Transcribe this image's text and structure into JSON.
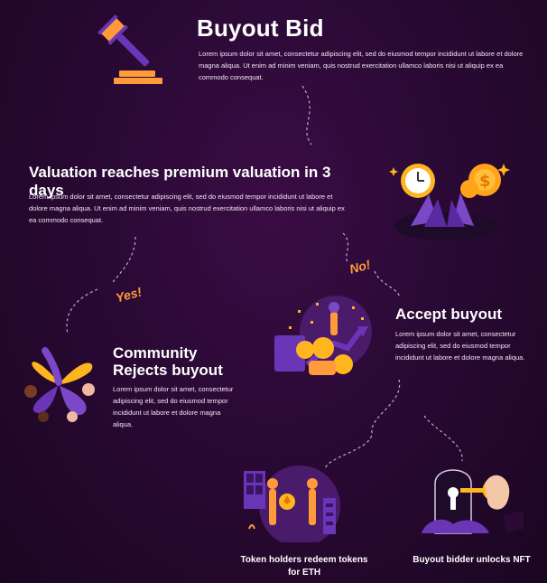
{
  "buyout_bid": {
    "title": "Buyout Bid",
    "body": "Lorem ipsum dolor sit amet, consectetur adipiscing elit, sed do eiusmod tempor incididunt ut labore et dolore magna aliqua. Ut enim ad minim veniam, quis nostrud exercitation ullamco laboris nisi ut aliquip ex ea commodo consequat."
  },
  "valuation": {
    "title": "Valuation reaches premium valuation in 3 days",
    "body": "Lorem ipsum dolor sit amet, consectetur adipiscing elit, sed do eiusmod tempor incididunt ut labore et dolore magna aliqua. Ut enim ad minim veniam, quis nostrud exercitation ullamco laboris nisi ut aliquip ex ea commodo consequat."
  },
  "branch": {
    "yes": "Yes!",
    "no": "No!"
  },
  "community": {
    "title_line1": "Community",
    "title_line2": "Rejects buyout",
    "body": "Lorem ipsum dolor sit amet, consectetur adipiscing elit, sed do eiusmod tempor incididunt ut labore et dolore magna aliqua."
  },
  "accept": {
    "title": "Accept buyout",
    "body": "Lorem ipsum dolor sit amet, consectetur adipiscing elit, sed do eiusmod tempor incididunt ut labore et dolore magna aliqua."
  },
  "redeem": {
    "caption_line1": "Token holders redeem tokens",
    "caption_line2": "for ETH"
  },
  "unlock": {
    "caption": "Buyout bidder unlocks NFT"
  },
  "icons": [
    "gavel-icon",
    "clocks-coins-icon",
    "celebration-icon",
    "hands-circle-icon",
    "token-exchange-icon",
    "key-lock-icon"
  ],
  "colors": {
    "accent_orange": "#ff9b3a",
    "accent_purple": "#6b35b8",
    "background": "#2a0934"
  }
}
